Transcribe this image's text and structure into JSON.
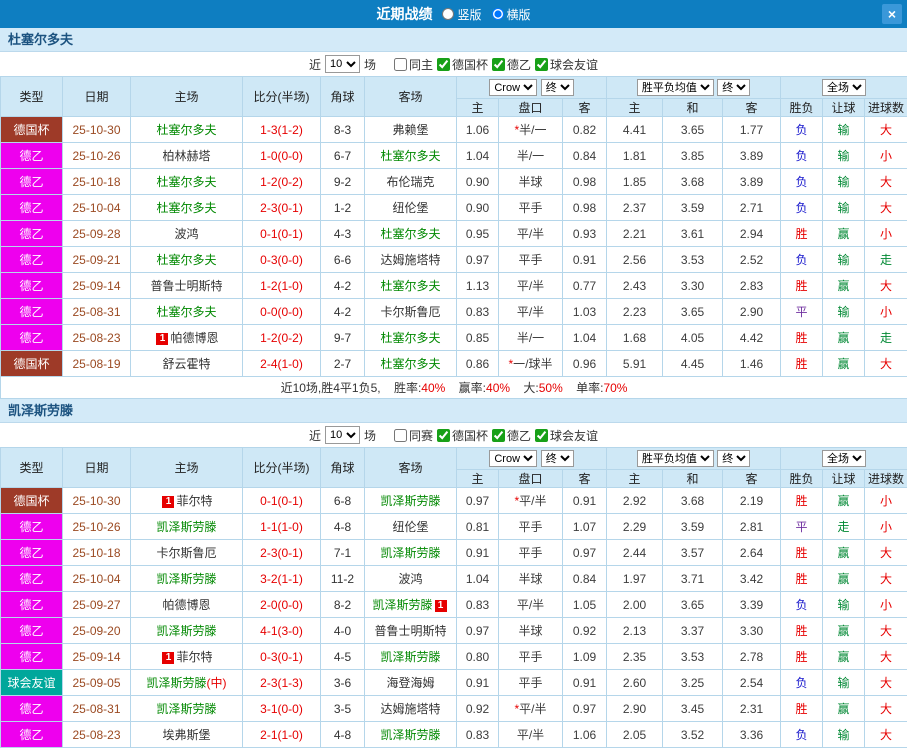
{
  "topbar": {
    "title": "近期战绩",
    "vertical_label": "竖版",
    "horizontal_label": "横版",
    "close_glyph": "×"
  },
  "filters": {
    "near_label": "近",
    "count": "10",
    "games_label": "场",
    "league_cup": "德国杯",
    "league_de2": "德乙",
    "league_friendly": "球会友谊"
  },
  "header": {
    "type": "类型",
    "date": "日期",
    "home": "主场",
    "score": "比分(半场)",
    "corner": "角球",
    "away": "客场",
    "odds_provider": "Crow",
    "final_a": "终",
    "avg": "胜平负均值",
    "final_b": "终",
    "full": "全场",
    "sub_home": "主",
    "sub_handicap": "盘口",
    "sub_away": "客",
    "sub_avg_home": "主",
    "sub_avg_draw": "和",
    "sub_avg_away": "客",
    "sub_result": "胜负",
    "sub_let": "让球",
    "sub_goals": "进球数"
  },
  "badge_glyph": "1",
  "league_colors": {
    "德国杯": "#9e3a28",
    "德乙": "#ee00ee",
    "球会友谊": "#00a79b"
  },
  "result_colors": {
    "胜": "#e60000",
    "平": "#7030a0",
    "负": "#1515cc",
    "赢": "#008833",
    "输": "#008833",
    "走": "#008833",
    "大": "#e60000",
    "小": "#e60000"
  },
  "sections": [
    {
      "title": "杜塞尔多夫",
      "filter_extra": "同主",
      "rows": [
        {
          "league": "德国杯",
          "date": "25-10-30",
          "home": "杜塞尔多夫",
          "home_green": true,
          "score": "1-3(1-2)",
          "corner": "8-3",
          "away": "弗赖堡",
          "away_green": false,
          "odds": [
            "1.06",
            "*半/一",
            "0.82"
          ],
          "avg": [
            "4.41",
            "3.65",
            "1.77"
          ],
          "results": [
            "负",
            "输",
            "大"
          ]
        },
        {
          "league": "德乙",
          "date": "25-10-26",
          "home": "柏林赫塔",
          "home_green": false,
          "score": "1-0(0-0)",
          "corner": "6-7",
          "away": "杜塞尔多夫",
          "away_green": true,
          "odds": [
            "1.04",
            "半/一",
            "0.84"
          ],
          "avg": [
            "1.81",
            "3.85",
            "3.89"
          ],
          "results": [
            "负",
            "输",
            "小"
          ]
        },
        {
          "league": "德乙",
          "date": "25-10-18",
          "home": "杜塞尔多夫",
          "home_green": true,
          "score": "1-2(0-2)",
          "corner": "9-2",
          "away": "布伦瑞克",
          "away_green": false,
          "odds": [
            "0.90",
            "半球",
            "0.98"
          ],
          "avg": [
            "1.85",
            "3.68",
            "3.89"
          ],
          "results": [
            "负",
            "输",
            "大"
          ]
        },
        {
          "league": "德乙",
          "date": "25-10-04",
          "home": "杜塞尔多夫",
          "home_green": true,
          "score": "2-3(0-1)",
          "corner": "1-2",
          "away": "纽伦堡",
          "away_green": false,
          "odds": [
            "0.90",
            "平手",
            "0.98"
          ],
          "avg": [
            "2.37",
            "3.59",
            "2.71"
          ],
          "results": [
            "负",
            "输",
            "大"
          ]
        },
        {
          "league": "德乙",
          "date": "25-09-28",
          "home": "波鸿",
          "home_green": false,
          "score": "0-1(0-1)",
          "corner": "4-3",
          "away": "杜塞尔多夫",
          "away_green": true,
          "odds": [
            "0.95",
            "平/半",
            "0.93"
          ],
          "avg": [
            "2.21",
            "3.61",
            "2.94"
          ],
          "results": [
            "胜",
            "赢",
            "小"
          ]
        },
        {
          "league": "德乙",
          "date": "25-09-21",
          "home": "杜塞尔多夫",
          "home_green": true,
          "score": "0-3(0-0)",
          "corner": "6-6",
          "away": "达姆施塔特",
          "away_green": false,
          "odds": [
            "0.97",
            "平手",
            "0.91"
          ],
          "avg": [
            "2.56",
            "3.53",
            "2.52"
          ],
          "results": [
            "负",
            "输",
            "走"
          ]
        },
        {
          "league": "德乙",
          "date": "25-09-14",
          "home": "普鲁士明斯特",
          "home_green": false,
          "score": "1-2(1-0)",
          "corner": "4-2",
          "away": "杜塞尔多夫",
          "away_green": true,
          "odds": [
            "1.13",
            "平/半",
            "0.77"
          ],
          "avg": [
            "2.43",
            "3.30",
            "2.83"
          ],
          "results": [
            "胜",
            "赢",
            "大"
          ]
        },
        {
          "league": "德乙",
          "date": "25-08-31",
          "home": "杜塞尔多夫",
          "home_green": true,
          "score": "0-0(0-0)",
          "corner": "4-2",
          "away": "卡尔斯鲁厄",
          "away_green": false,
          "odds": [
            "0.83",
            "平/半",
            "1.03"
          ],
          "avg": [
            "2.23",
            "3.65",
            "2.90"
          ],
          "results": [
            "平",
            "输",
            "小"
          ]
        },
        {
          "league": "德乙",
          "date": "25-08-23",
          "home": "帕德博恩",
          "home_green": false,
          "home_badge": "pre",
          "score": "1-2(0-2)",
          "corner": "9-7",
          "away": "杜塞尔多夫",
          "away_green": true,
          "odds": [
            "0.85",
            "半/一",
            "1.04"
          ],
          "avg": [
            "1.68",
            "4.05",
            "4.42"
          ],
          "results": [
            "胜",
            "赢",
            "走"
          ]
        },
        {
          "league": "德国杯",
          "date": "25-08-19",
          "home": "舒云霍特",
          "home_green": false,
          "score": "2-4(1-0)",
          "corner": "2-7",
          "away": "杜塞尔多夫",
          "away_green": true,
          "odds": [
            "0.86",
            "*一/球半",
            "0.96"
          ],
          "avg": [
            "5.91",
            "4.45",
            "1.46"
          ],
          "results": [
            "胜",
            "赢",
            "大"
          ]
        }
      ],
      "summary": {
        "prefix": "近10场,胜4平1负5,",
        "win_label": "胜率:",
        "win_value": "40%",
        "let_label": "赢率:",
        "let_value": "40%",
        "big_label": "大:",
        "big_value": "50%",
        "odd_label": "单率:",
        "odd_value": "70%"
      }
    },
    {
      "title": "凯泽斯劳滕",
      "filter_extra": "同赛",
      "rows": [
        {
          "league": "德国杯",
          "date": "25-10-30",
          "home": "菲尔特",
          "home_green": false,
          "home_badge": "pre",
          "score": "0-1(0-1)",
          "corner": "6-8",
          "away": "凯泽斯劳滕",
          "away_green": true,
          "odds": [
            "0.97",
            "*平/半",
            "0.91"
          ],
          "avg": [
            "2.92",
            "3.68",
            "2.19"
          ],
          "results": [
            "胜",
            "赢",
            "小"
          ]
        },
        {
          "league": "德乙",
          "date": "25-10-26",
          "home": "凯泽斯劳滕",
          "home_green": true,
          "score": "1-1(1-0)",
          "corner": "4-8",
          "away": "纽伦堡",
          "away_green": false,
          "odds": [
            "0.81",
            "平手",
            "1.07"
          ],
          "avg": [
            "2.29",
            "3.59",
            "2.81"
          ],
          "results": [
            "平",
            "走",
            "小"
          ]
        },
        {
          "league": "德乙",
          "date": "25-10-18",
          "home": "卡尔斯鲁厄",
          "home_green": false,
          "score": "2-3(0-1)",
          "corner": "7-1",
          "away": "凯泽斯劳滕",
          "away_green": true,
          "odds": [
            "0.91",
            "平手",
            "0.97"
          ],
          "avg": [
            "2.44",
            "3.57",
            "2.64"
          ],
          "results": [
            "胜",
            "赢",
            "大"
          ]
        },
        {
          "league": "德乙",
          "date": "25-10-04",
          "home": "凯泽斯劳滕",
          "home_green": true,
          "score": "3-2(1-1)",
          "corner": "11-2",
          "away": "波鸿",
          "away_green": false,
          "odds": [
            "1.04",
            "半球",
            "0.84"
          ],
          "avg": [
            "1.97",
            "3.71",
            "3.42"
          ],
          "results": [
            "胜",
            "赢",
            "大"
          ]
        },
        {
          "league": "德乙",
          "date": "25-09-27",
          "home": "帕德博恩",
          "home_green": false,
          "score": "2-0(0-0)",
          "corner": "8-2",
          "away": "凯泽斯劳滕",
          "away_green": true,
          "away_badge": "post",
          "odds": [
            "0.83",
            "平/半",
            "1.05"
          ],
          "avg": [
            "2.00",
            "3.65",
            "3.39"
          ],
          "results": [
            "负",
            "输",
            "小"
          ]
        },
        {
          "league": "德乙",
          "date": "25-09-20",
          "home": "凯泽斯劳滕",
          "home_green": true,
          "score": "4-1(3-0)",
          "corner": "4-0",
          "away": "普鲁士明斯特",
          "away_green": false,
          "odds": [
            "0.97",
            "半球",
            "0.92"
          ],
          "avg": [
            "2.13",
            "3.37",
            "3.30"
          ],
          "results": [
            "胜",
            "赢",
            "大"
          ]
        },
        {
          "league": "德乙",
          "date": "25-09-14",
          "home": "菲尔特",
          "home_green": false,
          "home_badge": "pre",
          "score": "0-3(0-1)",
          "corner": "4-5",
          "away": "凯泽斯劳滕",
          "away_green": true,
          "odds": [
            "0.80",
            "平手",
            "1.09"
          ],
          "avg": [
            "2.35",
            "3.53",
            "2.78"
          ],
          "results": [
            "胜",
            "赢",
            "大"
          ]
        },
        {
          "league": "球会友谊",
          "date": "25-09-05",
          "home": "凯泽斯劳滕",
          "home_green": true,
          "home_note": "(中)",
          "score": "2-3(1-3)",
          "corner": "3-6",
          "away": "海登海姆",
          "away_green": false,
          "odds": [
            "0.91",
            "平手",
            "0.91"
          ],
          "avg": [
            "2.60",
            "3.25",
            "2.54"
          ],
          "results": [
            "负",
            "输",
            "大"
          ]
        },
        {
          "league": "德乙",
          "date": "25-08-31",
          "home": "凯泽斯劳滕",
          "home_green": true,
          "score": "3-1(0-0)",
          "corner": "3-5",
          "away": "达姆施塔特",
          "away_green": false,
          "odds": [
            "0.92",
            "*平/半",
            "0.97"
          ],
          "avg": [
            "2.90",
            "3.45",
            "2.31"
          ],
          "results": [
            "胜",
            "赢",
            "大"
          ]
        },
        {
          "league": "德乙",
          "date": "25-08-23",
          "home": "埃弗斯堡",
          "home_green": false,
          "score": "2-1(1-0)",
          "corner": "4-8",
          "away": "凯泽斯劳滕",
          "away_green": true,
          "odds": [
            "0.83",
            "平/半",
            "1.06"
          ],
          "avg": [
            "2.05",
            "3.52",
            "3.36"
          ],
          "results": [
            "负",
            "输",
            "大"
          ]
        }
      ]
    }
  ]
}
